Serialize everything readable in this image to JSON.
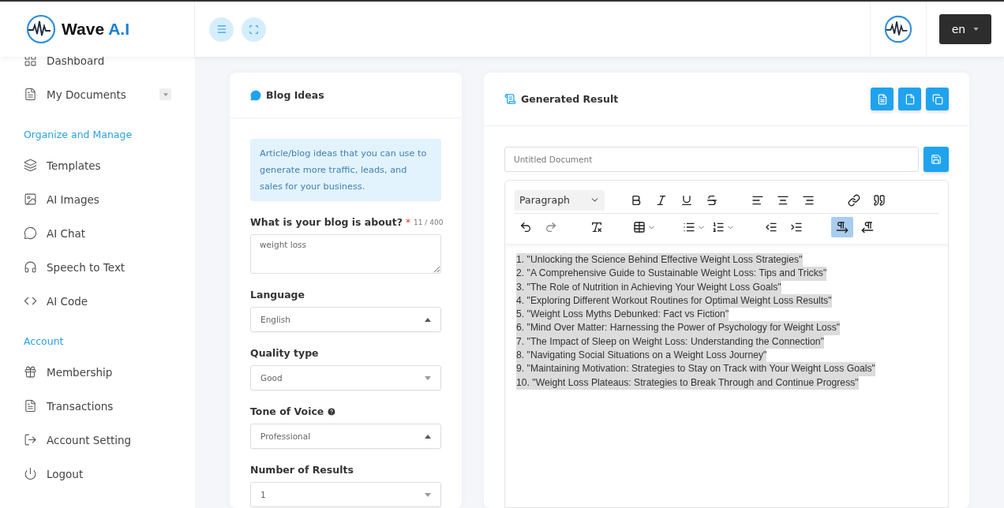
{
  "header": {
    "logo": {
      "text": "Wave ",
      "accent": "A.I"
    },
    "language": "en"
  },
  "sidebar": {
    "sections": [
      {
        "items": [
          {
            "kind": "dashboard",
            "label": "Dashboard"
          },
          {
            "kind": "documents",
            "label": "My Documents",
            "expandable": true
          }
        ]
      },
      {
        "title": "Organize and Manage",
        "items": [
          {
            "kind": "templates",
            "label": "Templates"
          },
          {
            "kind": "images",
            "label": "AI Images"
          },
          {
            "kind": "chat",
            "label": "AI Chat"
          },
          {
            "kind": "speech",
            "label": "Speech to Text"
          },
          {
            "kind": "code",
            "label": "AI Code"
          }
        ]
      },
      {
        "title": "Account",
        "items": [
          {
            "kind": "membership",
            "label": "Membership"
          },
          {
            "kind": "transactions",
            "label": "Transactions"
          },
          {
            "kind": "setting",
            "label": "Account Setting"
          },
          {
            "kind": "logout",
            "label": "Logout"
          }
        ]
      }
    ]
  },
  "form": {
    "title": "Blog Ideas",
    "info": "Article/blog ideas that you can use to generate more traffic, leads, and sales for your business.",
    "topic": {
      "label": "What is your blog is about?",
      "required": "*",
      "count": "11 / 400",
      "value": "weight loss"
    },
    "selects": [
      {
        "label": "Language",
        "value": "English",
        "expanded": true,
        "help": false
      },
      {
        "label": "Quality type",
        "value": "Good",
        "expanded": false,
        "help": false
      },
      {
        "label": "Tone of Voice",
        "value": "Professional",
        "expanded": true,
        "help": true
      },
      {
        "label": "Number of Results",
        "value": "1",
        "expanded": false,
        "help": false
      }
    ]
  },
  "result": {
    "title": "Generated Result",
    "exports": [
      {
        "kind": "word"
      },
      {
        "kind": "file"
      },
      {
        "kind": "copy"
      }
    ],
    "document": {
      "placeholder": "Untitled Document"
    },
    "block_format": "Paragraph",
    "toolbar": [
      [
        {
          "kind": "bold",
          "selected": false
        },
        {
          "kind": "italic",
          "selected": false
        },
        {
          "kind": "underline",
          "selected": false
        },
        {
          "kind": "strike",
          "selected": false
        },
        {
          "kind": "gap"
        },
        {
          "kind": "align-left",
          "selected": false
        },
        {
          "kind": "align-center",
          "selected": false
        },
        {
          "kind": "align-right",
          "selected": false
        },
        {
          "kind": "gap"
        },
        {
          "kind": "link",
          "selected": false
        },
        {
          "kind": "quote",
          "selected": false
        }
      ],
      [
        {
          "kind": "undo",
          "selected": false
        },
        {
          "kind": "redo",
          "selected": false
        },
        {
          "kind": "gap"
        },
        {
          "kind": "clear",
          "selected": false
        },
        {
          "kind": "gap"
        },
        {
          "kind": "table",
          "selected": false
        },
        {
          "kind": "gap"
        },
        {
          "kind": "bullets",
          "selected": false
        },
        {
          "kind": "numbers",
          "selected": false
        },
        {
          "kind": "gap"
        },
        {
          "kind": "outdent",
          "selected": false
        },
        {
          "kind": "indent",
          "selected": false
        },
        {
          "kind": "gap"
        },
        {
          "kind": "ltr",
          "selected": true
        },
        {
          "kind": "rtl",
          "selected": false
        }
      ]
    ],
    "lines_selected": true,
    "lines": [
      "1. \"Unlocking the Science Behind Effective Weight Loss Strategies\"",
      "2. \"A Comprehensive Guide to Sustainable Weight Loss: Tips and Tricks\"",
      "3. \"The Role of Nutrition in Achieving Your Weight Loss Goals\"",
      "4. \"Exploring Different Workout Routines for Optimal Weight Loss Results\"",
      "5. \"Weight Loss Myths Debunked: Fact vs Fiction\"",
      "6. \"Mind Over Matter: Harnessing the Power of Psychology for Weight Loss\"",
      "7. \"The Impact of Sleep on Weight Loss: Understanding the Connection\"",
      "8. \"Navigating Social Situations on a Weight Loss Journey\"",
      "9. \"Maintaining Motivation: Strategies to Stay on Track with Your Weight Loss Goals\"",
      "10. \"Weight Loss Plateaus: Strategies to Break Through and Continue Progress\""
    ]
  }
}
